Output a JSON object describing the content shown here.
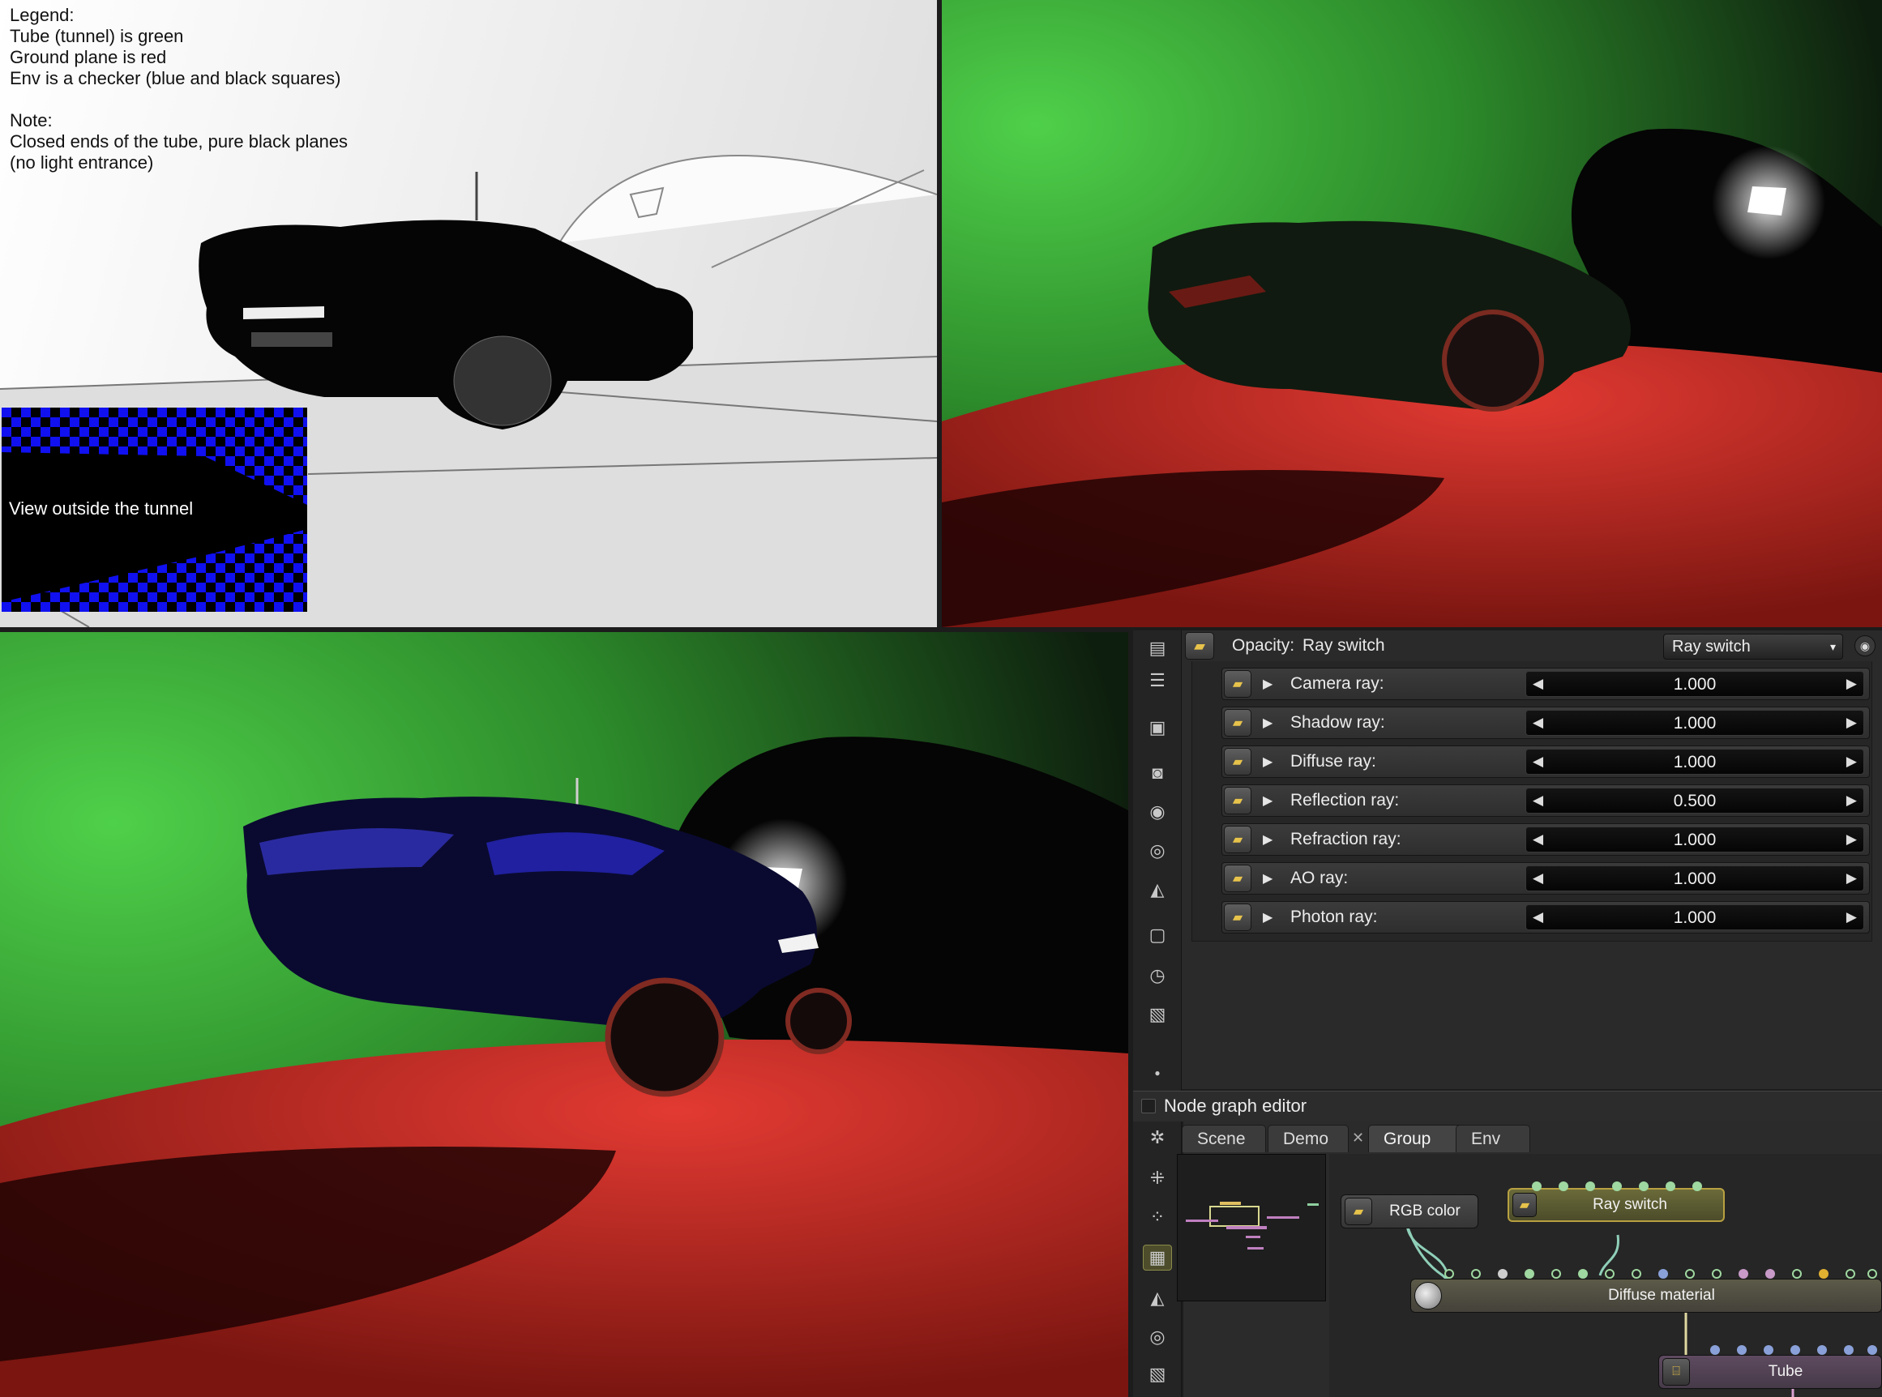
{
  "top_left_viewport": {
    "legend_lines": [
      "Legend:",
      "Tube (tunnel) is green",
      "Ground plane is red",
      "Env is a checker (blue and black squares)",
      "",
      "Note:",
      "Closed ends of the tube, pure black planes",
      "(no light entrance)"
    ],
    "inset_label": "View outside the tunnel"
  },
  "inspector": {
    "header_label": "Opacity:",
    "header_value": "Ray switch",
    "dropdown_value": "Ray switch",
    "rows": [
      {
        "label": "Camera ray:",
        "value": "1.000"
      },
      {
        "label": "Shadow ray:",
        "value": "1.000"
      },
      {
        "label": "Diffuse ray:",
        "value": "1.000"
      },
      {
        "label": "Reflection ray:",
        "value": "0.500"
      },
      {
        "label": "Refraction ray:",
        "value": "1.000"
      },
      {
        "label": "AO ray:",
        "value": "1.000"
      },
      {
        "label": "Photon ray:",
        "value": "1.000"
      }
    ]
  },
  "node_graph": {
    "title": "Node graph editor",
    "tabs": [
      "Scene",
      "Demo",
      "Group",
      "Env"
    ],
    "active_tab": "Group",
    "nodes": {
      "rgb": "RGB color",
      "ray_switch": "Ray switch",
      "diffuse": "Diffuse material",
      "tube": "Tube"
    }
  },
  "colors": {
    "tube": "#3cb838",
    "ground": "#d8322c",
    "env_blue": "#1010f0",
    "accent": "#e7c34b"
  },
  "icons": {
    "pin": "image-pin-icon",
    "expand": "play-triangle-icon",
    "eye": "eye-icon"
  }
}
